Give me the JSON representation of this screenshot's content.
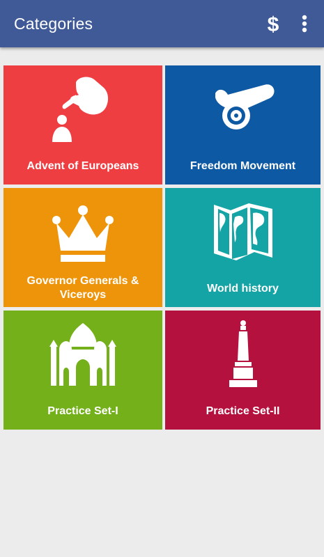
{
  "app_bar": {
    "title": "Categories",
    "actions": [
      {
        "name": "dollar-icon",
        "label": "$"
      },
      {
        "name": "overflow-menu-icon",
        "label": "more options"
      }
    ]
  },
  "categories": [
    {
      "label": "Advent of Europeans",
      "color": "#ef3e42",
      "icon": "pointing-hand-person-icon"
    },
    {
      "label": "Freedom Movement",
      "color": "#0e59a3",
      "icon": "cannon-icon"
    },
    {
      "label": "Governor Generals & Viceroys",
      "color": "#ee940a",
      "icon": "crown-icon"
    },
    {
      "label": "World history",
      "color": "#15a4a5",
      "icon": "world-map-icon"
    },
    {
      "label": "Practice Set-I",
      "color": "#74b01a",
      "icon": "taj-mahal-icon"
    },
    {
      "label": "Practice Set-II",
      "color": "#b5113e",
      "icon": "pillar-monument-icon"
    }
  ]
}
